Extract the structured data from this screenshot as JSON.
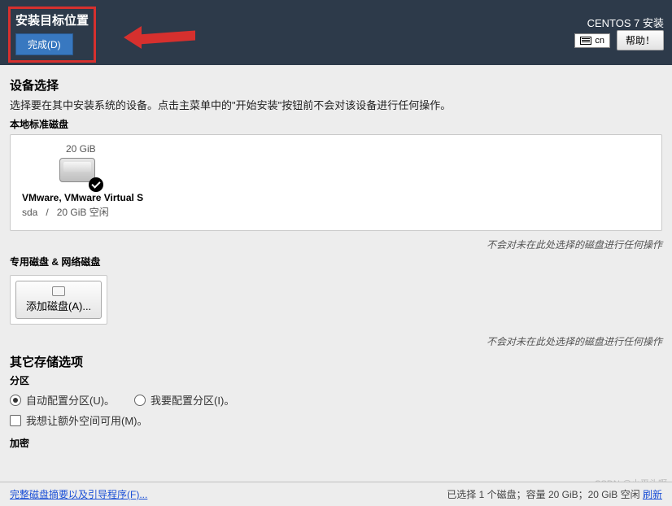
{
  "header": {
    "title": "安装目标位置",
    "done_button": "完成(D)",
    "product": "CENTOS 7 安装",
    "keyboard": "cn",
    "help": "帮助！"
  },
  "device_selection": {
    "title": "设备选择",
    "description": "选择要在其中安装系统的设备。点击主菜单中的\"开始安装\"按钮前不会对该设备进行任何操作。"
  },
  "local_disks": {
    "label": "本地标准磁盘",
    "disk": {
      "size": "20 GiB",
      "name": "VMware, VMware Virtual S",
      "device": "sda",
      "sep": "/",
      "free": "20 GiB 空闲"
    },
    "hint": "不会对未在此处选择的磁盘进行任何操作"
  },
  "special_disks": {
    "label": "专用磁盘 & 网络磁盘",
    "add_button": "添加磁盘(A)...",
    "hint": "不会对未在此处选择的磁盘进行任何操作"
  },
  "other_storage": {
    "title": "其它存储选项",
    "partition_label": "分区",
    "auto_partition": "自动配置分区(U)。",
    "manual_partition": "我要配置分区(I)。",
    "extra_space": "我想让额外空间可用(M)。",
    "encryption_label": "加密"
  },
  "bottom": {
    "summary_link": "完整磁盘摘要以及引导程序(F)...",
    "status_prefix": "已选择 1 个磁盘；容量 20 GiB；20 GiB 空闲 ",
    "refresh": "刷新"
  },
  "watermark": "CSDN @小平头啊"
}
